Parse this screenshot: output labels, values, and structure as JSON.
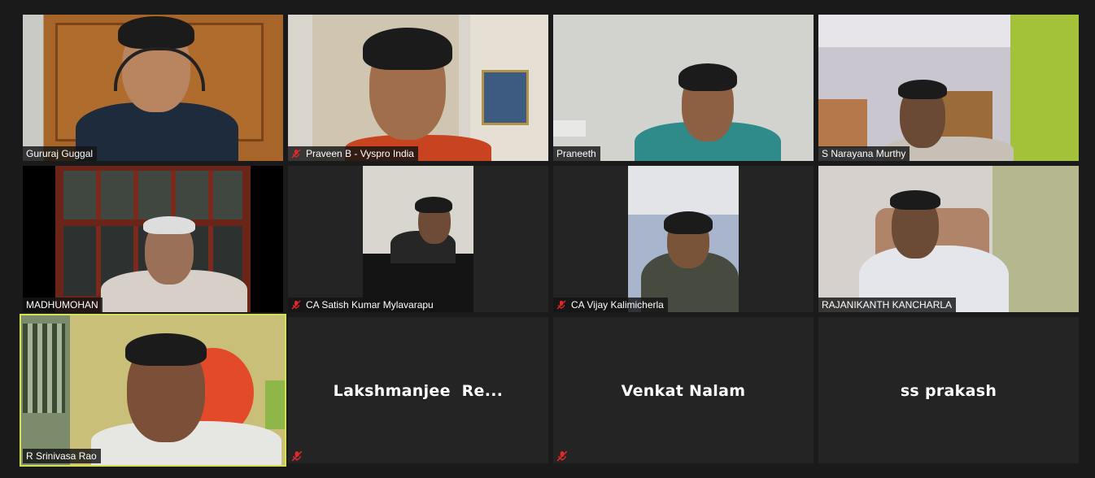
{
  "participants": [
    {
      "name": "Gururaj Guggal",
      "muted": false
    },
    {
      "name": "Praveen B - Vyspro India",
      "muted": true
    },
    {
      "name": "Praneeth",
      "muted": false
    },
    {
      "name": "S Narayana Murthy",
      "muted": false
    },
    {
      "name": "MADHUMOHAN",
      "muted": false
    },
    {
      "name": "CA Satish Kumar Mylavarapu",
      "muted": true
    },
    {
      "name": "CA Vijay Kalimicherla",
      "muted": true
    },
    {
      "name": "RAJANIKANTH KANCHARLA",
      "muted": false
    },
    {
      "name": "R Srinivasa Rao",
      "muted": false,
      "active_speaker": true
    },
    {
      "name": "Lakshmanjee  Re...",
      "muted": true,
      "video": false
    },
    {
      "name": "Venkat Nalam",
      "muted": true,
      "video": false
    },
    {
      "name": "ss prakash",
      "muted": false,
      "video": false
    }
  ],
  "colors": {
    "background": "#1a1a1a",
    "tile_empty": "#242424",
    "active_border": "#d4e157",
    "mute_red": "#e02828"
  },
  "icons": {
    "mute": "microphone-muted-icon"
  }
}
